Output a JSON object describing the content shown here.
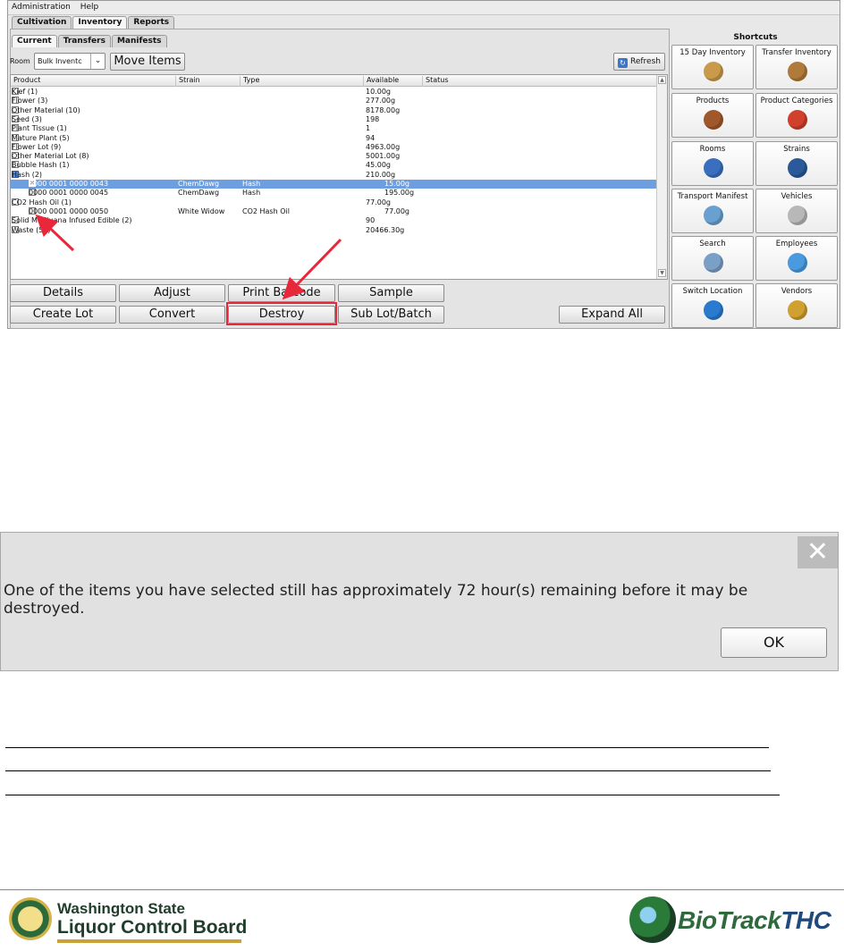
{
  "menu": [
    "Administration",
    "Help"
  ],
  "main_tabs": [
    "Cultivation",
    "Inventory",
    "Reports"
  ],
  "sub_tabs": [
    "Current",
    "Transfers",
    "Manifests"
  ],
  "room": {
    "label": "Room",
    "value": "Bulk Inventc"
  },
  "move_items": "Move Items",
  "refresh": "Refresh",
  "columns": [
    "Product",
    "Strain",
    "Type",
    "Available",
    "Status"
  ],
  "rows": [
    {
      "product": "Kief (1)",
      "strain": "",
      "type": "",
      "available": "10.00g"
    },
    {
      "product": "Flower (3)",
      "strain": "",
      "type": "",
      "available": "277.00g"
    },
    {
      "product": "Other Material (10)",
      "strain": "",
      "type": "",
      "available": "8178.00g"
    },
    {
      "product": "Seed (3)",
      "strain": "",
      "type": "",
      "available": "198"
    },
    {
      "product": "Plant Tissue (1)",
      "strain": "",
      "type": "",
      "available": "1"
    },
    {
      "product": "Mature Plant (5)",
      "strain": "",
      "type": "",
      "available": "94"
    },
    {
      "product": "Flower Lot (9)",
      "strain": "",
      "type": "",
      "available": "4963.00g"
    },
    {
      "product": "Other Material Lot (8)",
      "strain": "",
      "type": "",
      "available": "5001.00g"
    },
    {
      "product": "Bubble Hash (1)",
      "strain": "",
      "type": "",
      "available": "45.00g"
    },
    {
      "product": "Hash (2)",
      "strain": "",
      "type": "",
      "available": "210.00g"
    },
    {
      "product": "0000 0001 0000 0043",
      "strain": "ChemDawg",
      "type": "Hash",
      "available": "15.00g"
    },
    {
      "product": "0000 0001 0000 0045",
      "strain": "ChemDawg",
      "type": "Hash",
      "available": "195.00g"
    },
    {
      "product": "CO2 Hash Oil (1)",
      "strain": "",
      "type": "",
      "available": "77.00g"
    },
    {
      "product": "0000 0001 0000 0050",
      "strain": "White Widow",
      "type": "CO2 Hash Oil",
      "available": "77.00g"
    },
    {
      "product": "Solid Marijuana Infused Edible (2)",
      "strain": "",
      "type": "",
      "available": "90"
    },
    {
      "product": "Waste (55)",
      "strain": "",
      "type": "",
      "available": "20466.30g"
    }
  ],
  "actions": {
    "details": "Details",
    "adjust": "Adjust",
    "print_barcode": "Print Barcode",
    "sample": "Sample",
    "create_lot": "Create Lot",
    "convert": "Convert",
    "destroy": "Destroy",
    "sub_lot": "Sub Lot/Batch",
    "expand_all": "Expand All"
  },
  "shortcuts": {
    "title": "Shortcuts",
    "items": [
      {
        "label": "15 Day Inventory",
        "icon": "inventory-box-icon",
        "color": "#c89a4a"
      },
      {
        "label": "Transfer Inventory",
        "icon": "transfer-box-icon",
        "color": "#b07a3a"
      },
      {
        "label": "Products",
        "icon": "product-box-icon",
        "color": "#a0582a"
      },
      {
        "label": "Product Categories",
        "icon": "question-box-icon",
        "color": "#d0402a"
      },
      {
        "label": "Rooms",
        "icon": "home-globe-icon",
        "color": "#3a6fc0"
      },
      {
        "label": "Strains",
        "icon": "dna-globe-icon",
        "color": "#2a5a9a"
      },
      {
        "label": "Transport Manifest",
        "icon": "clipboard-icon",
        "color": "#6aa0d0"
      },
      {
        "label": "Vehicles",
        "icon": "car-icon",
        "color": "#b8b8b8"
      },
      {
        "label": "Search",
        "icon": "magnifier-icon",
        "color": "#7aa0c8"
      },
      {
        "label": "Employees",
        "icon": "people-icon",
        "color": "#4a9ae0"
      },
      {
        "label": "Switch Location",
        "icon": "switch-arrows-icon",
        "color": "#2a7ad0"
      },
      {
        "label": "Vendors",
        "icon": "vendor-gears-icon",
        "color": "#d0a030"
      }
    ]
  },
  "dialog": {
    "message": "One of the items you have selected still has approximately 72 hour(s) remaining before it may be destroyed.",
    "ok": "OK"
  },
  "footer": {
    "wslcb_line1": "Washington State",
    "wslcb_line2": "Liquor Control Board",
    "biotrack_a": "BioTrack",
    "biotrack_b": "THC"
  },
  "colors": {
    "annotation_red": "#e8283a",
    "selected_row": "#6d9ee0"
  }
}
